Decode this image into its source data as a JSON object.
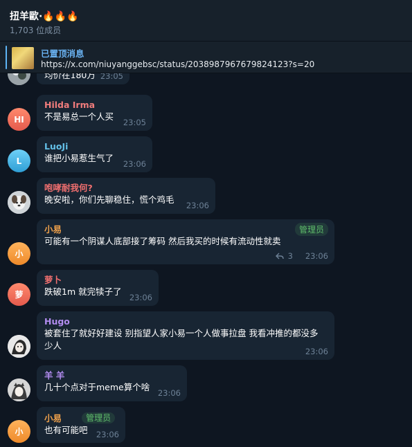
{
  "header": {
    "title": "扭羊歐·🔥🔥🔥",
    "members": "1,703 位成员"
  },
  "pinned": {
    "label": "已置顶消息",
    "text": "https://x.com/niuyanggebsc/status/2038987967679824123?s=20"
  },
  "messages": [
    {
      "text": "均价在180万",
      "time": "23:05"
    },
    {
      "author": "Hilda Irma",
      "initials": "HI",
      "text": "不是易总一个人买",
      "time": "23:05"
    },
    {
      "author": "LuoJi",
      "initials": "L",
      "text": "谁把小易惹生气了",
      "time": "23:06"
    },
    {
      "author": "咆哮耐我何?",
      "text": "晚安啦，你们先聊稳住，慌个鸡毛",
      "time": "23:06"
    },
    {
      "author": "小易",
      "initials": "小",
      "badge": "管理员",
      "text": "可能有一个阴谋人底部接了筹码 然后我买的时候有流动性就卖",
      "replies": "3",
      "time": "23:06"
    },
    {
      "author": "萝卜",
      "initials": "萝",
      "text": "跌破1m 就完犊子了",
      "time": "23:06"
    },
    {
      "author": "Hugo",
      "text": "被套住了就好好建设 别指望人家小易一个人做事拉盘 我看冲推的都没多少人",
      "time": "23:06"
    },
    {
      "author": "羊 羊",
      "text": "几十个点对于meme算个啥",
      "time": "23:06"
    },
    {
      "author": "小易",
      "initials": "小",
      "badge": "管理员",
      "text": "也有可能吧",
      "time": "23:06"
    }
  ],
  "colors": {
    "background": "#0e1621",
    "panel": "#17212b",
    "bubble": "#182533",
    "accent": "#6ab3f3",
    "name_hilda": "#f07c7c",
    "name_luoji": "#63c0e8",
    "name_paoxiao": "#f06f6f",
    "name_xiaoyi": "#f0a14b",
    "name_luobo": "#f06f6f",
    "name_hugo": "#b28cf0",
    "name_yangyang": "#b28cf0",
    "admin_badge": "#5fbd6b"
  },
  "icons": {
    "reply": "reply-arrow-icon"
  }
}
